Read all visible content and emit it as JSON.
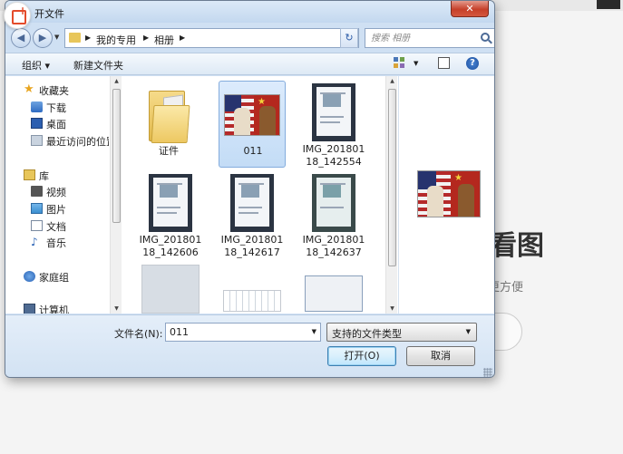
{
  "background_app": {
    "title_partial": "看图",
    "subtitle_partial": "更方便"
  },
  "dialog": {
    "title": "开文件",
    "close_label": "✕",
    "back_glyph": "◀",
    "forward_glyph": "▶",
    "breadcrumbs": [
      "我的专用",
      "相册"
    ],
    "search_placeholder": "搜索 相册",
    "toolbar": {
      "organize": "组织 ▾",
      "new_folder": "新建文件夹",
      "help": "?"
    },
    "nav": {
      "favorites": "收藏夹",
      "downloads": "下载",
      "desktop": "桌面",
      "recent": "最近访问的位置",
      "libraries": "库",
      "videos": "视频",
      "pictures": "图片",
      "documents": "文档",
      "music": "音乐",
      "homegroup": "家庭组",
      "computer": "计算机"
    },
    "files": [
      {
        "label": "证件",
        "kind": "folder"
      },
      {
        "label": "011",
        "kind": "image",
        "selected": true
      },
      {
        "label": "IMG_201801\n18_142554",
        "kind": "photo"
      },
      {
        "label": "IMG_201801\n18_142606",
        "kind": "photo"
      },
      {
        "label": "IMG_201801\n18_142617",
        "kind": "photo"
      },
      {
        "label": "IMG_201801\n18_142637",
        "kind": "photo"
      },
      {
        "label": "",
        "kind": "photo"
      },
      {
        "label": "",
        "kind": "photo"
      },
      {
        "label": "",
        "kind": "photo"
      }
    ],
    "filename_label": "文件名(N):",
    "filename_value": "011",
    "filetype_value": "支持的文件类型",
    "open_button": "打开(O)",
    "cancel_button": "取消"
  },
  "colors": {
    "accent": "#3c7fb1",
    "close": "#c6402a",
    "selection": "#c3dcf6"
  }
}
